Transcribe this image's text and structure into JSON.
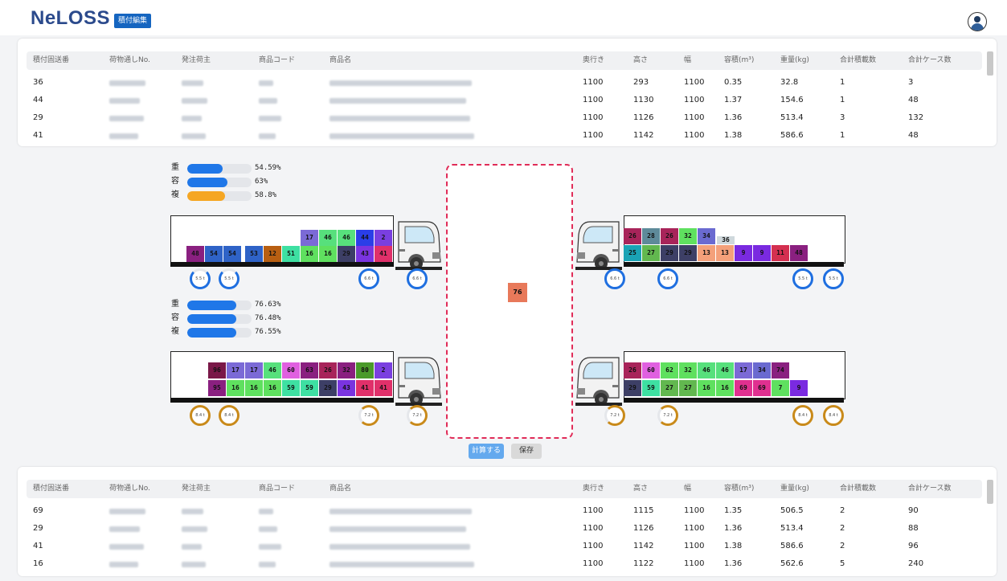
{
  "header": {
    "logo": "NeLOSS",
    "edit_button": "積付編集"
  },
  "table_headers": [
    "積付固送番",
    "荷物通しNo.",
    "発注荷主",
    "商品コード",
    "商品名",
    "奥行き",
    "高さ",
    "幅",
    "容積(m³)",
    "重量(kg)",
    "合計積載数",
    "合計ケース数"
  ],
  "bottom_table_headers": [
    "積付固送番",
    "荷物通しNo.",
    "発注荷主",
    "商品コード",
    "商品名",
    "奥行き",
    "高さ",
    "幅",
    "容積(m³)",
    "重量(kg)",
    "合計積載数",
    "合計ケース数"
  ],
  "top_rows": [
    [
      "36",
      "1100",
      "293",
      "1100",
      "0.35",
      "32.8",
      "1",
      "3"
    ],
    [
      "44",
      "1100",
      "1130",
      "1100",
      "1.37",
      "154.6",
      "1",
      "48"
    ],
    [
      "29",
      "1100",
      "1126",
      "1100",
      "1.36",
      "513.4",
      "3",
      "132"
    ],
    [
      "41",
      "1100",
      "1142",
      "1100",
      "1.38",
      "586.6",
      "1",
      "48"
    ]
  ],
  "bottom_rows": [
    [
      "69",
      "1100",
      "1115",
      "1100",
      "1.35",
      "506.5",
      "2",
      "90"
    ],
    [
      "29",
      "1100",
      "1126",
      "1100",
      "1.36",
      "513.4",
      "2",
      "88"
    ],
    [
      "41",
      "1100",
      "1142",
      "1100",
      "1.38",
      "586.6",
      "2",
      "96"
    ],
    [
      "16",
      "1100",
      "1122",
      "1100",
      "1.36",
      "562.6",
      "5",
      "240"
    ]
  ],
  "stats_group1": [
    {
      "label": "重",
      "value": "54.59%",
      "fraction": 0.5459,
      "color": "#1f77e8"
    },
    {
      "label": "容",
      "value": "63%",
      "fraction": 0.63,
      "color": "#1f77e8"
    },
    {
      "label": "複",
      "value": "58.8%",
      "fraction": 0.588,
      "color": "#f5a623"
    }
  ],
  "stats_group2": [
    {
      "label": "重",
      "value": "76.63%",
      "fraction": 0.7663,
      "color": "#1f77e8"
    },
    {
      "label": "容",
      "value": "76.48%",
      "fraction": 0.7648,
      "color": "#1f77e8"
    },
    {
      "label": "複",
      "value": "76.55%",
      "fraction": 0.7655,
      "color": "#1f77e8"
    }
  ],
  "trucks": [
    {
      "name": "truck-left-1",
      "wheels": [
        "5.5 t",
        "5.5 t",
        "6.6 t",
        "6.6 t"
      ],
      "upper": [
        [
          "17",
          "#7b6ad6"
        ],
        [
          "46",
          "#57e07c"
        ],
        [
          "46",
          "#57e07c"
        ],
        [
          "44",
          "#2a3ee8"
        ],
        [
          "2",
          "#7a3fe0"
        ]
      ],
      "middle": [
        [
          "53",
          "#2f63c7"
        ],
        [
          "12",
          "#b85f12"
        ],
        [
          "51",
          "#3ee0a2"
        ],
        [
          "16",
          "#5fe05f"
        ],
        [
          "16",
          "#5fe05f"
        ],
        [
          "29",
          "#3d3f66"
        ],
        [
          "43",
          "#7a34e0"
        ],
        [
          "41",
          "#e0306a"
        ]
      ],
      "lower": [
        [
          "48",
          "#8a2080"
        ],
        [
          "54",
          "#2f63c7"
        ],
        [
          "54",
          "#2f63c7"
        ]
      ]
    },
    {
      "name": "truck-right-1",
      "wheels": [
        "6.6 t",
        "6.6 t",
        "5.5 t",
        "5.5 t"
      ],
      "upper": [
        [
          "26",
          "#a8245a"
        ],
        [
          "28",
          "#5e8a9a"
        ],
        [
          "26",
          "#a8245a"
        ],
        [
          "32",
          "#5fe05f"
        ],
        [
          "34",
          "#6a6ad0"
        ]
      ],
      "lower": [
        [
          "25",
          "#1aa3b5"
        ],
        [
          "27",
          "#62b84f"
        ],
        [
          "29",
          "#3d3f66"
        ],
        [
          "29",
          "#3d3f66"
        ],
        [
          "13",
          "#f4a07a"
        ],
        [
          "13",
          "#f4a07a"
        ],
        [
          "9",
          "#7a2ae0"
        ],
        [
          "9",
          "#7a2ae0"
        ],
        [
          "11",
          "#d43050"
        ],
        [
          "48",
          "#8a2080"
        ]
      ],
      "extra": "36"
    },
    {
      "name": "truck-left-2",
      "wheels": [
        "8.4 t",
        "8.4 t",
        "7.2 t",
        "7.2 t"
      ],
      "upper": [
        [
          "96",
          "#7a1848"
        ],
        [
          "17",
          "#7b6ad6"
        ],
        [
          "17",
          "#7b6ad6"
        ],
        [
          "46",
          "#57e07c"
        ],
        [
          "60",
          "#e060e0"
        ],
        [
          "63",
          "#8a2080"
        ],
        [
          "26",
          "#a8245a"
        ],
        [
          "32",
          "#8a2080"
        ],
        [
          "80",
          "#4a9a2a"
        ],
        [
          "2",
          "#7a3fe0"
        ]
      ],
      "lower": [
        [
          "95",
          "#8a2080"
        ],
        [
          "16",
          "#5fe05f"
        ],
        [
          "16",
          "#5fe05f"
        ],
        [
          "16",
          "#5fe05f"
        ],
        [
          "59",
          "#3ee0a2"
        ],
        [
          "59",
          "#3ee0a2"
        ],
        [
          "29",
          "#3d3f66"
        ],
        [
          "43",
          "#7a34e0"
        ],
        [
          "41",
          "#e0306a"
        ],
        [
          "41",
          "#e0306a"
        ]
      ]
    },
    {
      "name": "truck-right-2",
      "wheels": [
        "7.2 t",
        "7.2 t",
        "8.4 t",
        "8.4 t"
      ],
      "upper": [
        [
          "26",
          "#a8245a"
        ],
        [
          "60",
          "#e060e0"
        ],
        [
          "62",
          "#5fe05f"
        ],
        [
          "32",
          "#5fe05f"
        ],
        [
          "46",
          "#57e07c"
        ],
        [
          "46",
          "#57e07c"
        ],
        [
          "17",
          "#7b6ad6"
        ],
        [
          "34",
          "#6a6ad0"
        ],
        [
          "74",
          "#8a2080"
        ]
      ],
      "lower": [
        [
          "29",
          "#3d3f66"
        ],
        [
          "59",
          "#3ee0a2"
        ],
        [
          "27",
          "#62b84f"
        ],
        [
          "27",
          "#62b84f"
        ],
        [
          "16",
          "#5fe05f"
        ],
        [
          "16",
          "#5fe05f"
        ],
        [
          "69",
          "#e03090"
        ],
        [
          "69",
          "#e03090"
        ],
        [
          "7",
          "#5fe05f"
        ],
        [
          "9",
          "#7a2ae0"
        ]
      ]
    }
  ],
  "dropzone": {
    "item": "76",
    "item_color": "#e8795a"
  },
  "buttons": {
    "calculate": "計算する",
    "save": "保存"
  }
}
